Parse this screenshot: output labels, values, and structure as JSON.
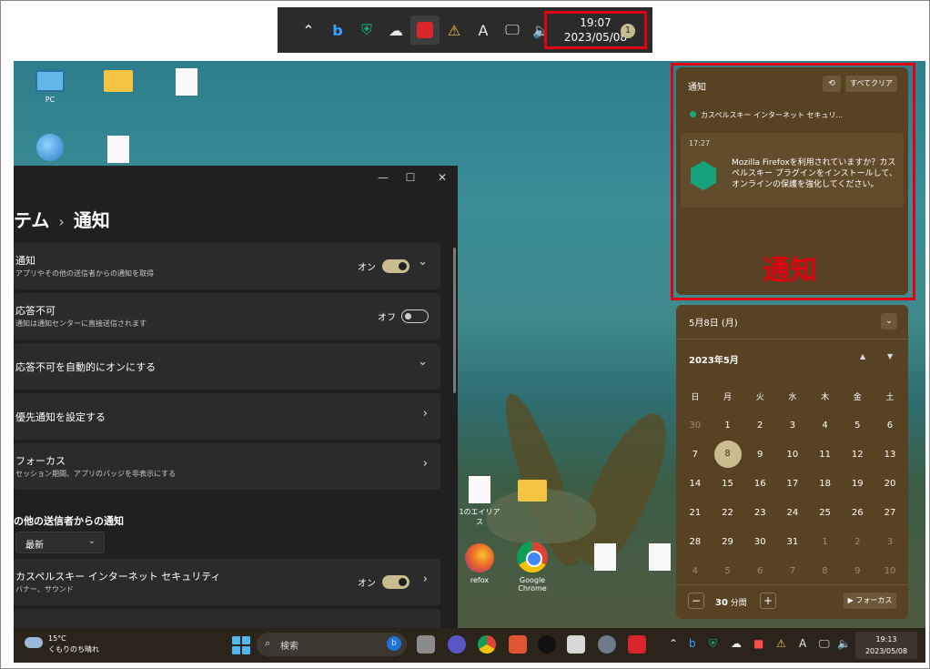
{
  "tray_zoom": {
    "icons": [
      "chevron-up-icon",
      "bing-icon",
      "shield-icon",
      "cloud-icon",
      "app-red-icon",
      "security-warning-icon",
      "ime-icon",
      "network-icon",
      "volume-icon"
    ],
    "ime_label": "A",
    "time": "19:07",
    "date": "2023/05/08",
    "badge": "1"
  },
  "desktop": {
    "icons": [
      {
        "name": "PC"
      },
      {
        "name": "Google Chrome"
      }
    ],
    "partial_labels": [
      "1のエイリア",
      "ス",
      "refox"
    ]
  },
  "settings": {
    "title_prefix": "テム",
    "title_sep": "›",
    "title": "通知",
    "cards": [
      {
        "title": "通知",
        "subtitle": "アプリやその他の送信者からの通知を取得",
        "state": "オン",
        "toggle": "on",
        "arrow": "⌄"
      },
      {
        "title": "応答不可",
        "subtitle": "通知は通知センターに直接送信されます",
        "state": "オフ",
        "toggle": "off",
        "arrow": ""
      },
      {
        "title": "応答不可を自動的にオンにする",
        "subtitle": "",
        "state": "",
        "toggle": "",
        "arrow": "⌄"
      },
      {
        "title": "優先通知を設定する",
        "subtitle": "",
        "state": "",
        "toggle": "",
        "arrow": "›"
      },
      {
        "title": "フォーカス",
        "subtitle": "セッション期間、アプリのバッジを非表示にする",
        "state": "",
        "toggle": "",
        "arrow": "›"
      }
    ],
    "senders_heading": "の他の送信者からの通知",
    "sort_value": "最新",
    "sender_card": {
      "title": "カスペルスキー インターネット セキュリティ",
      "subtitle": "バナー、サウンド",
      "state": "オン",
      "arrow": "›"
    }
  },
  "notifications": {
    "title": "通知",
    "clear_all": "すべてクリア",
    "app_name": "カスペルスキー インターネット セキュリ...",
    "time": "17:27",
    "message": "Mozilla Firefoxを利用されていますか？カスペルスキー プラグインをインストールして、オンラインの保護を強化してください。",
    "overlay_label": "通知"
  },
  "calendar": {
    "header": "5月8日 (月)",
    "month": "2023年5月",
    "weekdays": [
      "日",
      "月",
      "火",
      "水",
      "木",
      "金",
      "土"
    ],
    "weeks": [
      [
        "30",
        "1",
        "2",
        "3",
        "4",
        "5",
        "6"
      ],
      [
        "7",
        "8",
        "9",
        "10",
        "11",
        "12",
        "13"
      ],
      [
        "14",
        "15",
        "16",
        "17",
        "18",
        "19",
        "20"
      ],
      [
        "21",
        "22",
        "23",
        "24",
        "25",
        "26",
        "27"
      ],
      [
        "28",
        "29",
        "30",
        "31",
        "1",
        "2",
        "3"
      ],
      [
        "4",
        "5",
        "6",
        "7",
        "8",
        "9",
        "10"
      ]
    ],
    "today": "8",
    "minutes_value": "30",
    "minutes_unit": "分間",
    "focus_button": "フォーカス"
  },
  "taskbar": {
    "weather_temp": "15°C",
    "weather_text": "くもりのち晴れ",
    "search_placeholder": "検索",
    "time": "19:13",
    "date": "2023/05/08",
    "ime_label": "A"
  }
}
